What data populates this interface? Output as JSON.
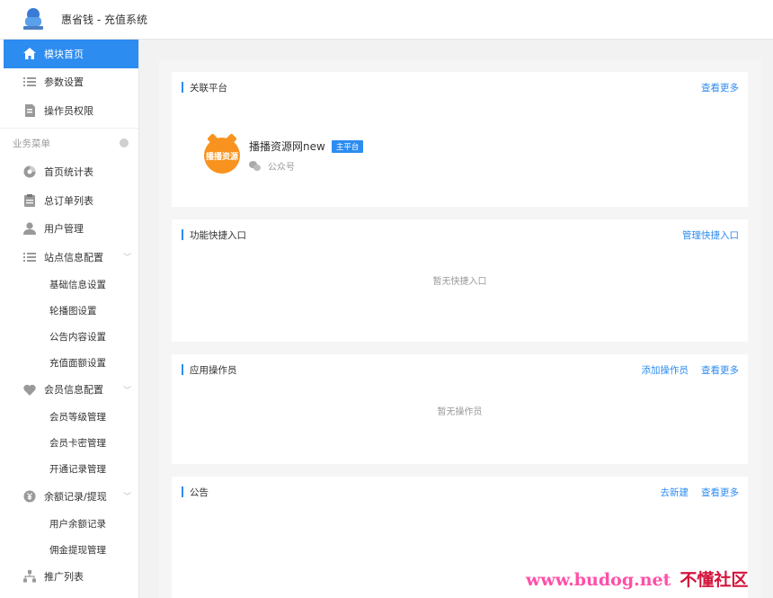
{
  "header": {
    "logo_text": "惠省钱",
    "title": "惠省钱 - 充值系统"
  },
  "sidebar": {
    "top_items": [
      {
        "label": "模块首页",
        "icon": "home-icon",
        "active": true
      },
      {
        "label": "参数设置",
        "icon": "list-icon"
      },
      {
        "label": "操作员权限",
        "icon": "document-icon"
      }
    ],
    "group_title": "业务菜单",
    "items": [
      {
        "label": "首页统计表",
        "icon": "chart-icon"
      },
      {
        "label": "总订单列表",
        "icon": "clipboard-icon"
      },
      {
        "label": "用户管理",
        "icon": "user-icon"
      },
      {
        "label": "站点信息配置",
        "icon": "list-icon",
        "children": [
          "基础信息设置",
          "轮播图设置",
          "公告内容设置",
          "充值面额设置"
        ]
      },
      {
        "label": "会员信息配置",
        "icon": "heart-icon",
        "children": [
          "会员等级管理",
          "会员卡密管理",
          "开通记录管理"
        ]
      },
      {
        "label": "余额记录/提现",
        "icon": "coin-icon",
        "children": [
          "用户余额记录",
          "佣金提现管理"
        ]
      },
      {
        "label": "推广列表",
        "icon": "tree-icon"
      }
    ]
  },
  "cards": {
    "platform": {
      "title": "关联平台",
      "link_more": "查看更多",
      "item": {
        "avatar_text": "播播资源",
        "name": "播播资源网new",
        "badge": "主平台",
        "type": "公众号"
      }
    },
    "shortcuts": {
      "title": "功能快捷入口",
      "link_manage": "管理快捷入口",
      "empty": "暂无快捷入口"
    },
    "operators": {
      "title": "应用操作员",
      "link_add": "添加操作员",
      "link_more": "查看更多",
      "empty": "暂无操作员"
    },
    "notice": {
      "title": "公告",
      "link_new": "去新建",
      "link_more": "查看更多"
    }
  },
  "watermark": {
    "url": "www.budog.net",
    "cn": "不懂社区"
  },
  "colors": {
    "accent": "#2d8cf0",
    "platform_avatar": "#f7931e"
  }
}
